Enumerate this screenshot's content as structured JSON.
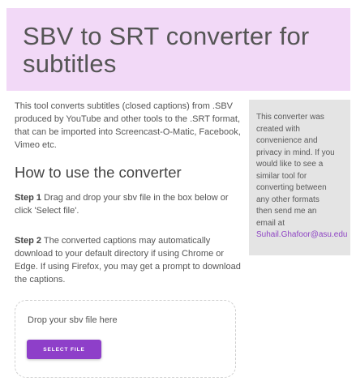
{
  "header": {
    "title_line1": "SBV to SRT converter for",
    "title_line2": "subtitles"
  },
  "main": {
    "intro_lines": [
      "This tool converts subtitles (closed captions) from .SBV",
      "produced by YouTube and other tools to the .SRT format,",
      "that can be imported into Screencast-O-Matic, Facebook,",
      "Vimeo etc."
    ],
    "howto_heading": "How to use the converter",
    "step1": {
      "label": "Step 1",
      "lines": [
        " Drag and drop your sbv file in the box below or",
        "click 'Select file'."
      ]
    },
    "step2": {
      "label": "Step 2",
      "lines": [
        " The converted captions may automatically",
        "download to your default directory if using Chrome or",
        "Edge. If using Firefox, you may get a prompt to download",
        "the captions."
      ]
    }
  },
  "dropzone": {
    "prompt": "Drop your sbv file here",
    "button_label": "SELECT FILE"
  },
  "sidebar": {
    "lines": [
      "This converter was",
      "created with",
      "convenience and",
      "privacy in mind. If you",
      "would like to see a",
      "similar tool for",
      "converting between",
      "any other formats",
      "then send me an",
      "email at"
    ],
    "email": "Suhail.Ghafoor@asu.edu"
  },
  "colors": {
    "header_bg": "#f2d9f7",
    "accent": "#8e3fc9",
    "sidebar_bg": "#e4e4e4",
    "link": "#8e44c4"
  }
}
